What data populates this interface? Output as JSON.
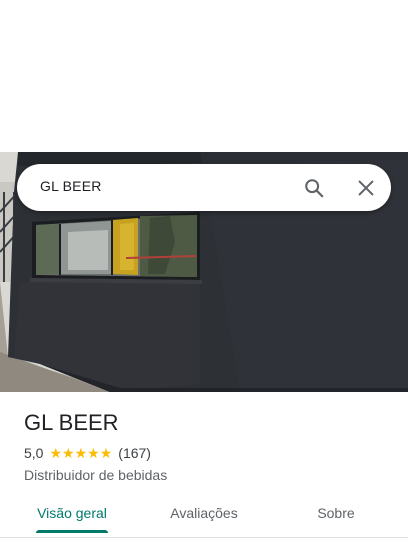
{
  "search": {
    "query": "GL BEER",
    "search_icon": "search-icon",
    "close_icon": "close-icon"
  },
  "place": {
    "name": "GL BEER",
    "rating": "5,0",
    "stars": 5,
    "reviews": "(167)",
    "category": "Distribuidor de bebidas"
  },
  "tabs": [
    {
      "label": "Visão geral",
      "active": true
    },
    {
      "label": "Avaliações",
      "active": false
    },
    {
      "label": "Sobre",
      "active": false
    }
  ],
  "colors": {
    "accent": "#00796b",
    "star": "#fbbc04",
    "wall": "#2b2e33"
  }
}
